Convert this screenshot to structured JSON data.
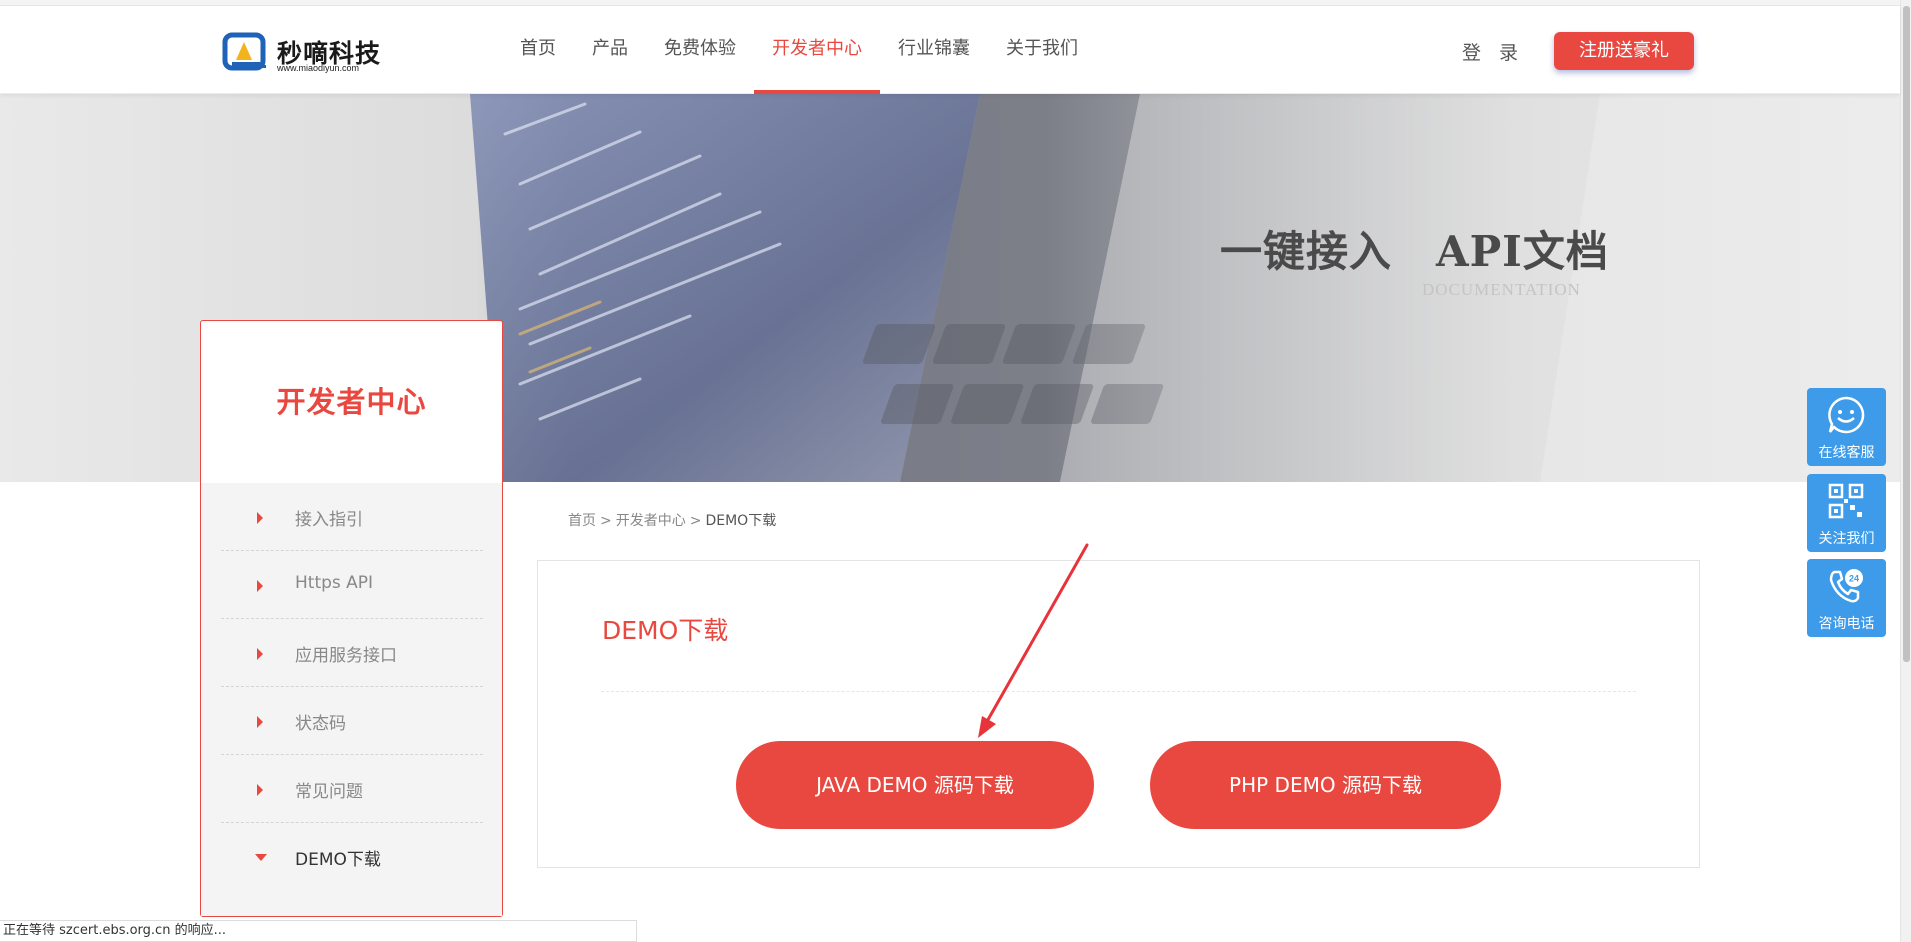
{
  "brand": {
    "name": "秒嘀科技",
    "url": "www.miaodiyun.com"
  },
  "nav": {
    "items": [
      {
        "label": "首页"
      },
      {
        "label": "产品"
      },
      {
        "label": "免费体验"
      },
      {
        "label": "开发者中心",
        "active": true
      },
      {
        "label": "行业锦囊"
      },
      {
        "label": "关于我们"
      }
    ],
    "login": "登 录",
    "register": "注册送豪礼"
  },
  "banner": {
    "title_left": "一键接入",
    "title_right": "API文档",
    "subtitle": "DOCUMENTATION"
  },
  "sidebar": {
    "title": "开发者中心",
    "items": [
      {
        "label": "接入指引"
      },
      {
        "label": "Https API"
      },
      {
        "label": "应用服务接口"
      },
      {
        "label": "状态码"
      },
      {
        "label": "常见问题"
      },
      {
        "label": "DEMO下载",
        "current": true
      }
    ]
  },
  "breadcrumb": {
    "home": "首页",
    "section": "开发者中心",
    "current": "DEMO下载",
    "separator": ">"
  },
  "content": {
    "title": "DEMO下载",
    "java_button": "JAVA DEMO 源码下载",
    "php_button": "PHP DEMO 源码下载"
  },
  "float_panel": {
    "service": "在线客服",
    "follow": "关注我们",
    "phone": "咨询电话"
  },
  "status_bar": "正在等待 szcert.ebs.org.cn 的响应...",
  "colors": {
    "accent": "#e8483f",
    "float_blue": "#3d9be9"
  }
}
